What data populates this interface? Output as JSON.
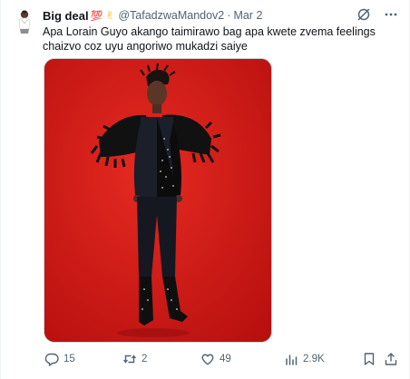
{
  "tweet": {
    "display_name": "Big deal",
    "emoji_hundred": "💯",
    "emoji_hand": "✌",
    "handle": "@TafadzwaMandov2",
    "separator": "·",
    "time": "Mar 2",
    "text": "Apa Lorain Guyo akango taimirawo bag apa kwete zvema feelings chaizvo coz uyu angoriwo mukadzi saiye",
    "icons": {
      "grok": "grok-icon",
      "more": "more-icon"
    },
    "media": {
      "icon": "photo",
      "background_color": "#d71a18",
      "subject": "person in black feathered outfit"
    }
  },
  "actions": {
    "reply_count": "15",
    "retweet_count": "2",
    "like_count": "49",
    "views_count": "2.9K"
  },
  "colors": {
    "text": "#0f1419",
    "secondary": "#536471",
    "media_bg": "#d71a18"
  }
}
